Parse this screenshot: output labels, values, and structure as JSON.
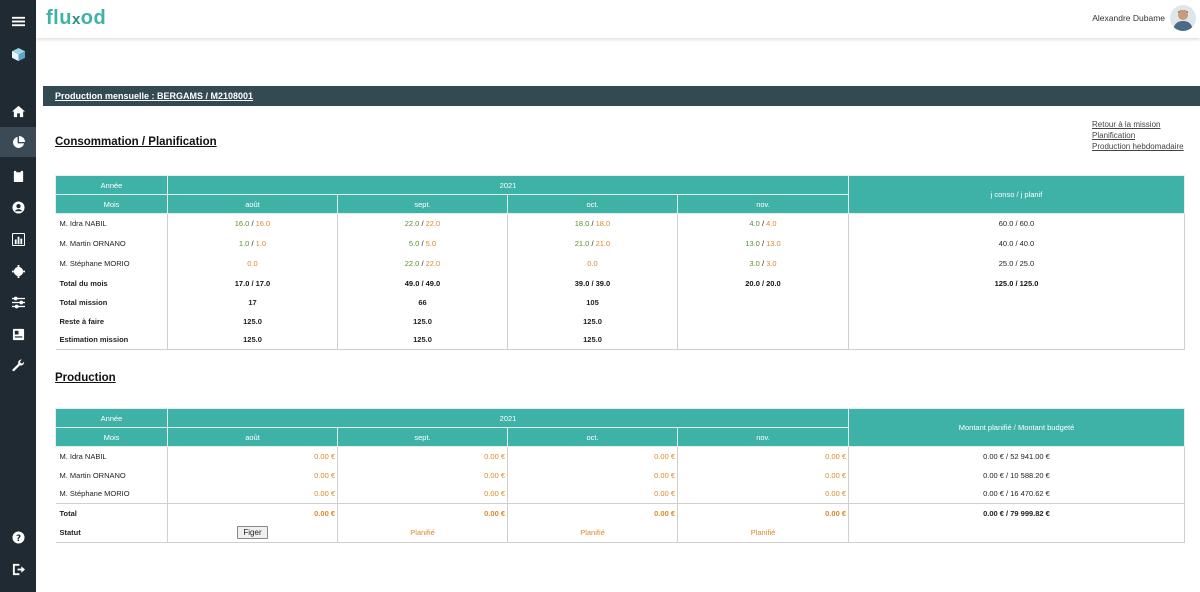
{
  "app": {
    "logo": "fluxod",
    "user_name": "Alexandre Dubame"
  },
  "sidebar": {
    "items": [
      {
        "icon": "menu-icon"
      },
      {
        "icon": "cube-icon"
      },
      {
        "icon": "home-icon"
      },
      {
        "icon": "pie-chart-icon"
      },
      {
        "icon": "clipboard-icon"
      },
      {
        "icon": "user-circle-icon"
      },
      {
        "icon": "bar-chart-icon"
      },
      {
        "icon": "gear-icon"
      },
      {
        "icon": "sliders-icon"
      },
      {
        "icon": "book-icon"
      },
      {
        "icon": "wrench-icon"
      },
      {
        "icon": "help-icon"
      },
      {
        "icon": "logout-icon"
      }
    ]
  },
  "page": {
    "header": "Production mensuelle : BERGAMS / M2108001"
  },
  "links": {
    "back": "Retour à la mission",
    "planning": "Planification",
    "weekly": "Production hebdomadaire"
  },
  "consumption": {
    "title": "Consommation / Planification",
    "year_label": "Année",
    "month_label": "Mois",
    "year": "2021",
    "months": [
      "août",
      "sept.",
      "oct.",
      "nov."
    ],
    "summary_header": "j conso / j planif",
    "rows": [
      {
        "name": "M. Idra NABIL",
        "cells": [
          [
            "16.0",
            "16.0"
          ],
          [
            "22.0",
            "22.0"
          ],
          [
            "18.0",
            "18.0"
          ],
          [
            "4.0",
            "4.0"
          ]
        ],
        "summary": "60.0 / 60.0"
      },
      {
        "name": "M. Martin ORNANO",
        "cells": [
          [
            "1.0",
            "1.0"
          ],
          [
            "5.0",
            "5.0"
          ],
          [
            "21.0",
            "21.0"
          ],
          [
            "13.0",
            "13.0"
          ]
        ],
        "summary": "40.0 / 40.0"
      },
      {
        "name": "M. Stéphane MORIO",
        "cells": [
          [
            "",
            "0.0"
          ],
          [
            "22.0",
            "22.0"
          ],
          [
            "",
            "0.0"
          ],
          [
            "3.0",
            "3.0"
          ]
        ],
        "summary": "25.0 / 25.0"
      }
    ],
    "total_month": {
      "label": "Total du mois",
      "values": [
        "17.0 / 17.0",
        "49.0 / 49.0",
        "39.0 / 39.0",
        "20.0 / 20.0"
      ],
      "summary": "125.0 / 125.0"
    },
    "total_mission": {
      "label": "Total mission",
      "values": [
        "17",
        "66",
        "105",
        ""
      ]
    },
    "remaining": {
      "label": "Reste à faire",
      "values": [
        "125.0",
        "125.0",
        "125.0",
        ""
      ]
    },
    "estimation": {
      "label": "Estimation mission",
      "values": [
        "125.0",
        "125.0",
        "125.0",
        ""
      ]
    }
  },
  "production": {
    "title": "Production",
    "year_label": "Année",
    "month_label": "Mois",
    "year": "2021",
    "months": [
      "août",
      "sept.",
      "oct.",
      "nov."
    ],
    "summary_header": "Montant planifié / Montant budgeté",
    "rows": [
      {
        "name": "M. Idra NABIL",
        "values": [
          "0.00 €",
          "0.00 €",
          "0.00 €",
          "0.00 €"
        ],
        "summary": "0.00 € / 52 941.00 €"
      },
      {
        "name": "M. Martin ORNANO",
        "values": [
          "0.00 €",
          "0.00 €",
          "0.00 €",
          "0.00 €"
        ],
        "summary": "0.00 € / 10 588.20 €"
      },
      {
        "name": "M. Stéphane MORIO",
        "values": [
          "0.00 €",
          "0.00 €",
          "0.00 €",
          "0.00 €"
        ],
        "summary": "0.00 € / 16 470.62 €"
      }
    ],
    "total": {
      "label": "Total",
      "values": [
        "0.00 €",
        "0.00 €",
        "0.00 €",
        "0.00 €"
      ],
      "summary": "0.00 € / 79 999.82 €"
    },
    "status": {
      "label": "Statut",
      "button": "Figer",
      "values": [
        "Planifié",
        "Planifié",
        "Planifié"
      ]
    }
  },
  "colors": {
    "teal": "#3fb2a8",
    "header_bar": "#344a52",
    "sidebar": "#1f2a33",
    "consumed": "#5a8f2b",
    "planned": "#d98a2b"
  }
}
